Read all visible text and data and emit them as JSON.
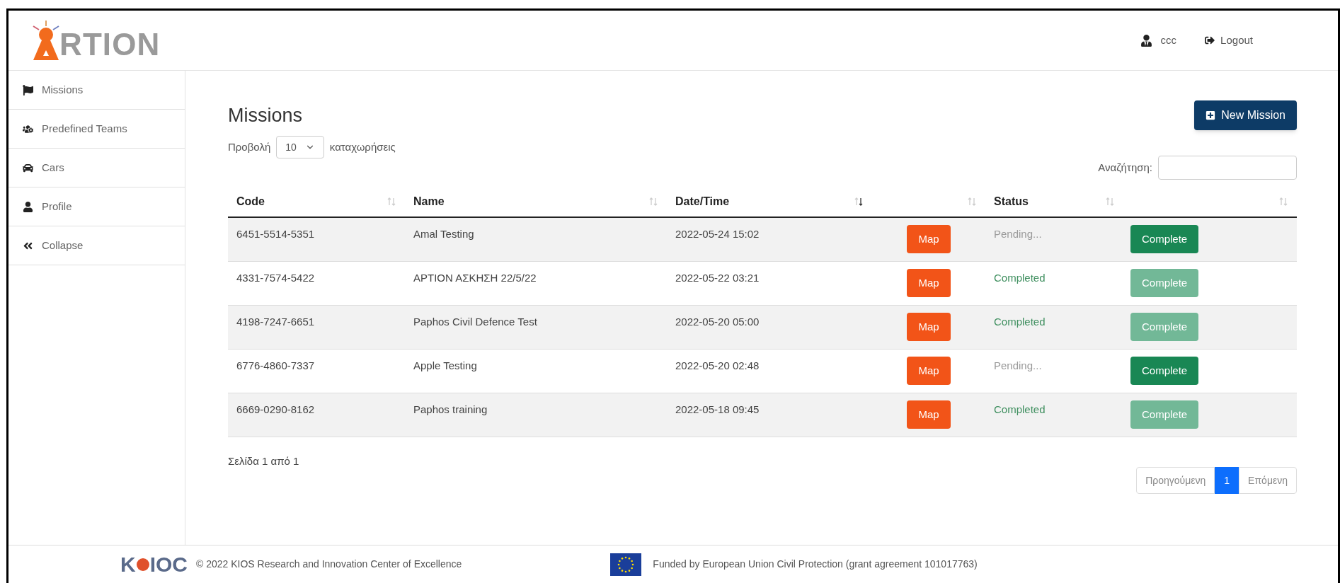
{
  "header": {
    "logo_text": "RTION",
    "user": "ccc",
    "logout": "Logout"
  },
  "sidebar": {
    "items": [
      {
        "label": "Missions",
        "kind": "flag"
      },
      {
        "label": "Predefined Teams",
        "kind": "users"
      },
      {
        "label": "Cars",
        "kind": "car"
      },
      {
        "label": "Profile",
        "kind": "user"
      },
      {
        "label": "Collapse",
        "kind": "collapse"
      }
    ]
  },
  "page": {
    "title": "Missions",
    "new_button": "New Mission",
    "show_label": "Προβολή",
    "page_size": "10",
    "entries_label": "καταχωρήσεις",
    "search_label": "Αναζήτηση:"
  },
  "table": {
    "columns": [
      {
        "label": "Code",
        "sorted": false
      },
      {
        "label": "Name",
        "sorted": false
      },
      {
        "label": "Date/Time",
        "sorted": true
      },
      {
        "sorted": false
      },
      {
        "label": "Status",
        "sorted": false
      },
      {
        "sorted": false
      }
    ],
    "rows": [
      {
        "code": "6451-5514-5351",
        "name": "Amal Testing",
        "datetime": "2022-05-24 15:02",
        "map": "Map",
        "status": "Pending...",
        "completed": false,
        "action": "Complete",
        "action_disabled": false
      },
      {
        "code": "4331-7574-5422",
        "name": "ΑΡΤΙΟΝ ΑΣΚΗΣΗ 22/5/22",
        "datetime": "2022-05-22 03:21",
        "map": "Map",
        "status": "Completed",
        "completed": true,
        "action": "Complete",
        "action_disabled": true
      },
      {
        "code": "4198-7247-6651",
        "name": "Paphos Civil Defence Test",
        "datetime": "2022-05-20 05:00",
        "map": "Map",
        "status": "Completed",
        "completed": true,
        "action": "Complete",
        "action_disabled": true
      },
      {
        "code": "6776-4860-7337",
        "name": "Apple Testing",
        "datetime": "2022-05-20 02:48",
        "map": "Map",
        "status": "Pending...",
        "completed": false,
        "action": "Complete",
        "action_disabled": false
      },
      {
        "code": "6669-0290-8162",
        "name": "Paphos training",
        "datetime": "2022-05-18 09:45",
        "map": "Map",
        "status": "Completed",
        "completed": true,
        "action": "Complete",
        "action_disabled": true
      }
    ]
  },
  "info": "Σελίδα 1 από 1",
  "pagination": [
    {
      "label": "Προηγούμενη",
      "kind": "prev",
      "selected": false,
      "disabled": true
    },
    {
      "label": "1",
      "kind": "page",
      "selected": true
    },
    {
      "label": "Επόμενη",
      "kind": "next",
      "selected": false,
      "disabled": true
    }
  ],
  "footer": {
    "logo_start": "K",
    "logo_end": "ΙΟϹ",
    "copyright": "© 2022 KIOS Research and Innovation Center of Excellence",
    "funding": "Funded by European Union Civil Protection (grant agreement 101017763)"
  }
}
